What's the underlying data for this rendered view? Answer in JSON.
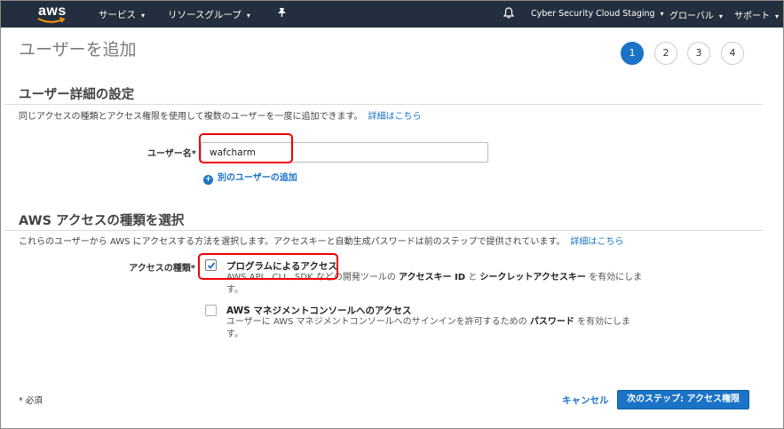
{
  "nav": {
    "logo": "aws",
    "services": "サービス",
    "resource_groups": "リソースグループ",
    "pin_icon": "pin-icon",
    "bell_icon": "bell-icon",
    "account": "Cyber Security Cloud Staging",
    "region": "グローバル",
    "support": "サポート",
    "caret": "▾",
    "colors": {
      "bg": "#232f3e",
      "text": "#ffffff",
      "smile": "#ff9900"
    }
  },
  "page": {
    "title": "ユーザーを追加",
    "steps": [
      "1",
      "2",
      "3",
      "4"
    ],
    "active_step": "1",
    "accent": "#1a73c7"
  },
  "user_details": {
    "heading": "ユーザー詳細の設定",
    "description": "同じアクセスの種類とアクセス権限を使用して複数のユーザーを一度に追加できます。",
    "learn_more": "詳細はこちら",
    "username_label": "ユーザー名*",
    "username_value": "wafcharm",
    "add_another": "別のユーザーの追加"
  },
  "access_type": {
    "heading": "AWS アクセスの種類を選択",
    "description": "これらのユーザーから AWS にアクセスする方法を選択します。アクセスキーと自動生成パスワードは前のステップで提供されています。",
    "learn_more": "詳細はこちら",
    "label": "アクセスの種類*",
    "options": [
      {
        "title": "プログラムによるアクセス",
        "checked": true,
        "desc_pre": "AWS API、CLI、SDK などの開発ツールの",
        "desc_b1": "アクセスキー ID",
        "desc_mid": "と",
        "desc_b2": "シークレットアクセスキー",
        "desc_post": "を有効にします。"
      },
      {
        "title": "AWS マネジメントコンソールへのアクセス",
        "checked": false,
        "desc_pre": "ユーザーに AWS マネジメントコンソールへのサインインを許可するための",
        "desc_b1": "パスワード",
        "desc_post": "を有効にします。"
      }
    ]
  },
  "footer": {
    "required_note": "* 必須",
    "cancel": "キャンセル",
    "next": "次のステップ: アクセス権限"
  },
  "annotation_color": "#e00000"
}
